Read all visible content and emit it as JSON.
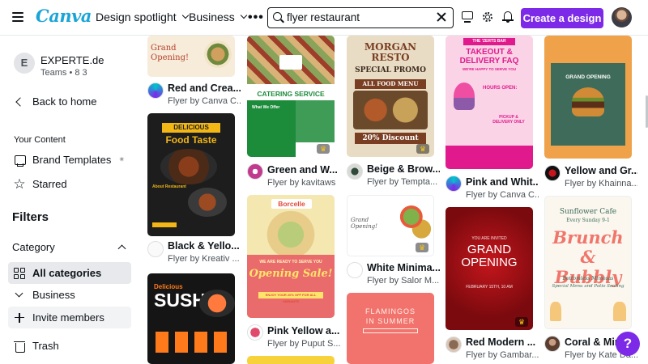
{
  "brand": {
    "logo": "Canva",
    "accent": "#7d2ae8"
  },
  "nav": {
    "design_spotlight": "Design spotlight",
    "business": "Business",
    "more": "•••"
  },
  "search": {
    "value": "flyer restaurant",
    "placeholder": "Search"
  },
  "toolbar": {
    "create_label": "Create a design"
  },
  "team": {
    "initial": "E",
    "name": "EXPERTE.de",
    "sub": "Teams • 8 3"
  },
  "sidebar": {
    "back": "Back to home",
    "your_content": "Your Content",
    "brand_templates": "Brand Templates",
    "starred": "Starred",
    "filters": "Filters",
    "category": "Category",
    "all_categories": "All categories",
    "business": "Business",
    "invite": "Invite members",
    "trash": "Trash"
  },
  "cards": [
    {
      "title": "Red and Crea...",
      "by": "Flyer by Canva C...",
      "t1": "Grand",
      "t2": "Opening!"
    },
    {
      "title": "Black & Yello...",
      "by": "Flyer by Kreativ ...",
      "t1": "DELICIOUS",
      "t2": "Food Taste",
      "t3": "About Restaurant"
    },
    {
      "title": "",
      "by": "",
      "t1": "Delicious",
      "t2": "SUSHI"
    },
    {
      "title": "Green and W...",
      "by": "Flyer by kavitaws",
      "t1": "CATERING SERVICE",
      "t2": "What We Offer"
    },
    {
      "title": "Pink Yellow a...",
      "by": "Flyer by Puput S...",
      "t1": "Borcelle",
      "t2": "WE ARE READY TO SERVE YOU",
      "t3": "Opening Sale!",
      "t4": "ENJOY YOUR 20% OFF FOR ALL VARIANTS"
    },
    {
      "title": "Beige & Brow...",
      "by": "Flyer by Tempta...",
      "t1": "MORGAN",
      "t2": "RESTO",
      "t3": "SPECIAL PROMO",
      "t4": "ALL FOOD MENU",
      "t5": "20% Discount"
    },
    {
      "title": "White Minima...",
      "by": "Flyer by Salor M...",
      "t1": "Grand Opening!"
    },
    {
      "title": "",
      "by": "",
      "t1": "FLAMINGOS",
      "t2": "IN SUMMER"
    },
    {
      "title": "Pink and Whit...",
      "by": "Flyer by Canva C...",
      "t1": "THE 'ZERTS BAR",
      "t2": "TAKEOUT &",
      "t3": "DELIVERY FAQ",
      "t4": "WE'RE HAPPY TO SERVE YOU",
      "t5": "HOURS OPEN:",
      "t6": "PICKUP & DELIVERY ONLY"
    },
    {
      "title": "Red Modern ...",
      "by": "Flyer by Gambar...",
      "t1": "YOU ARE INVITED",
      "t2": "GRAND",
      "t3": "OPENING",
      "t4": "FEBRUARY 15TH, 10 AM"
    },
    {
      "title": "Yellow and Gr...",
      "by": "Flyer by Khainna...",
      "t1": "GRAND OPENING"
    },
    {
      "title": "Coral & Mint...",
      "by": "Flyer by Kate Da...",
      "t1": "Sunflower Cafe",
      "t2": "Every Sunday 9-1",
      "t3": "Brunch",
      "t4": "& Bubbly",
      "t5": "Bottomless Mimosas",
      "t6": "Special Menu and Patio Seating"
    }
  ],
  "help": "?"
}
